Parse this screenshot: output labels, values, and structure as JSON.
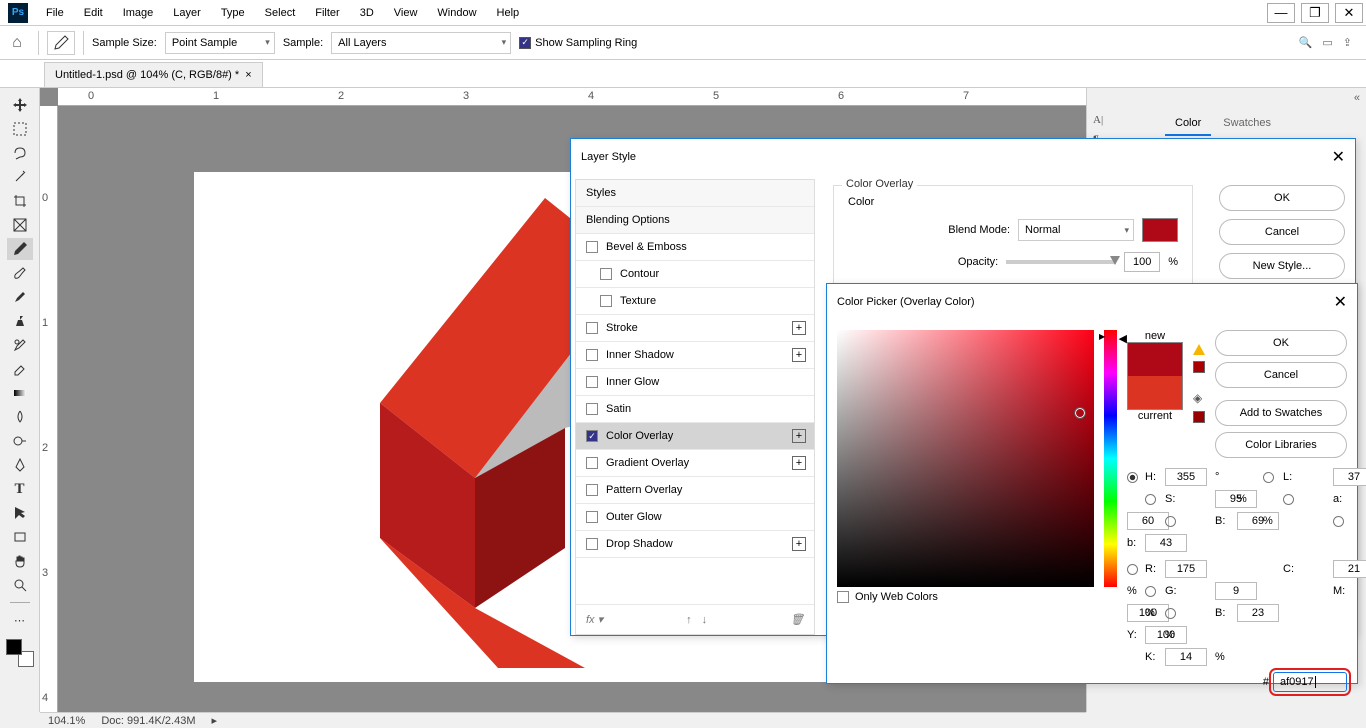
{
  "menubar": {
    "items": [
      "File",
      "Edit",
      "Image",
      "Layer",
      "Type",
      "Select",
      "Filter",
      "3D",
      "View",
      "Window",
      "Help"
    ]
  },
  "optionsbar": {
    "sample_size_label": "Sample Size:",
    "sample_size_value": "Point Sample",
    "sample_label": "Sample:",
    "sample_value": "All Layers",
    "show_sampling_ring": "Show Sampling Ring"
  },
  "doc_tab": "Untitled-1.psd @ 104% (C, RGB/8#) *",
  "ruler_h": [
    "0",
    "1",
    "2",
    "3",
    "4",
    "5",
    "6",
    "7"
  ],
  "ruler_v": [
    "0",
    "1",
    "2",
    "3",
    "4"
  ],
  "panels": {
    "tabs": [
      "Color",
      "Swatches"
    ]
  },
  "statusbar": {
    "zoom": "104.1%",
    "doc_info": "Doc: 991.4K/2.43M"
  },
  "layer_style": {
    "title": "Layer Style",
    "list": {
      "styles": "Styles",
      "blending_options": "Blending Options",
      "bevel_emboss": "Bevel & Emboss",
      "contour": "Contour",
      "texture": "Texture",
      "stroke": "Stroke",
      "inner_shadow": "Inner Shadow",
      "inner_glow": "Inner Glow",
      "satin": "Satin",
      "color_overlay": "Color Overlay",
      "gradient_overlay": "Gradient Overlay",
      "pattern_overlay": "Pattern Overlay",
      "outer_glow": "Outer Glow",
      "drop_shadow": "Drop Shadow"
    },
    "center": {
      "section": "Color Overlay",
      "color_label": "Color",
      "blend_mode_label": "Blend Mode:",
      "blend_mode_value": "Normal",
      "opacity_label": "Opacity:",
      "opacity_value": "100",
      "opacity_unit": "%"
    },
    "buttons": {
      "ok": "OK",
      "cancel": "Cancel",
      "new_style": "New Style..."
    }
  },
  "color_picker": {
    "title": "Color Picker (Overlay Color)",
    "new_label": "new",
    "current_label": "current",
    "buttons": {
      "ok": "OK",
      "cancel": "Cancel",
      "add_swatches": "Add to Swatches",
      "color_libraries": "Color Libraries"
    },
    "only_web": "Only Web Colors",
    "values": {
      "H": "355",
      "H_unit": "°",
      "S": "95",
      "S_unit": "%",
      "Bhsb": "69",
      "Bhsb_unit": "%",
      "L": "37",
      "a": "60",
      "b_lab": "43",
      "R": "175",
      "G": "9",
      "Brgb": "23",
      "C": "21",
      "C_unit": "%",
      "M": "100",
      "M_unit": "%",
      "Y": "100",
      "Y_unit": "%",
      "K": "14",
      "K_unit": "%"
    },
    "hex_label": "#",
    "hex_value": "af0917"
  }
}
